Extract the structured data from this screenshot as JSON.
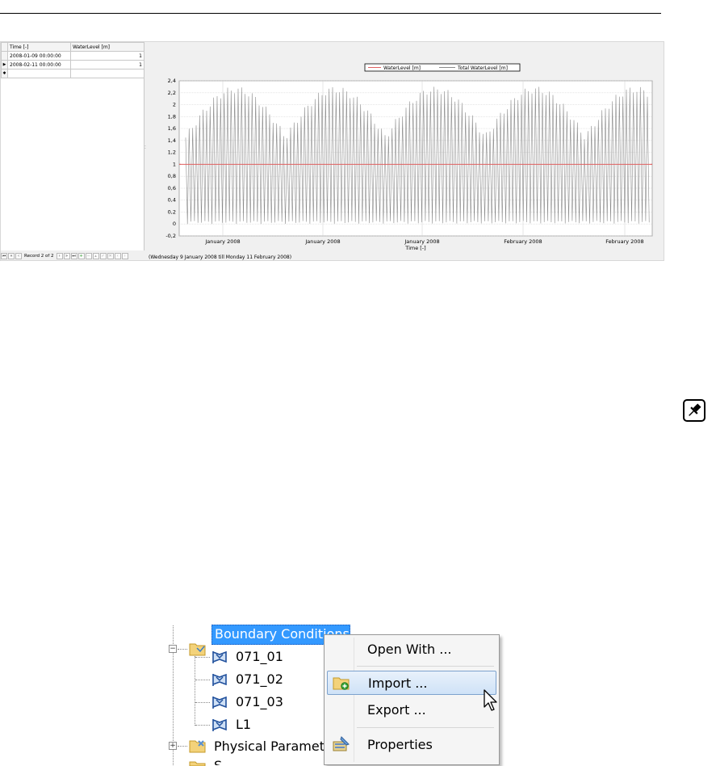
{
  "grid": {
    "headers": [
      "Time [-]",
      "WaterLevel [m]"
    ],
    "rows": [
      {
        "time": "2008-01-09 00:00:00",
        "value": "1"
      },
      {
        "time": "2008-02-11 00:00:00",
        "value": "1"
      }
    ]
  },
  "navigator": {
    "record_text": "Record 2 of 2"
  },
  "chart": {
    "range_text": "(Wednesday 9 January 2008 till Monday 11 February 2008)",
    "colors": {
      "waterlevel": "#e06060",
      "total": "#8a8a8a"
    }
  },
  "chart_data": {
    "type": "line",
    "xlabel": "Time [-]",
    "ylabel": "",
    "ylim": [
      -0.2,
      2.4
    ],
    "ytick_labels": [
      "2,4",
      "2,2",
      "2",
      "1,8",
      "1,6",
      "1,4",
      "1,2",
      "1",
      "0,8",
      "0,6",
      "0,4",
      "0,2",
      "0",
      "-0,2"
    ],
    "xtick_labels": [
      "January 2008",
      "January 2008",
      "January 2008",
      "February 2008",
      "February 2008"
    ],
    "legend": "top-center",
    "grid": true,
    "series": [
      {
        "name": "WaterLevel [m]",
        "x": [
          "2008-01-09",
          "2008-02-11"
        ],
        "values": [
          1,
          1
        ]
      },
      {
        "name": "Total WaterLevel [m]",
        "values_min": 0.0,
        "values_max": 2.3
      }
    ]
  },
  "tree": {
    "selected_label": "Boundary Conditions",
    "children": [
      "071_01",
      "071_02",
      "071_03",
      "L1"
    ],
    "next_label": "Physical Paramet",
    "cut_label": "S"
  },
  "context_menu": {
    "items": [
      {
        "label": "Open With ...",
        "icon": "none"
      },
      {
        "label": "Import ...",
        "icon": "folder-import-icon",
        "highlighted": true
      },
      {
        "label": "Export ...",
        "icon": "none"
      },
      {
        "label": "Properties",
        "icon": "properties-icon"
      }
    ]
  }
}
